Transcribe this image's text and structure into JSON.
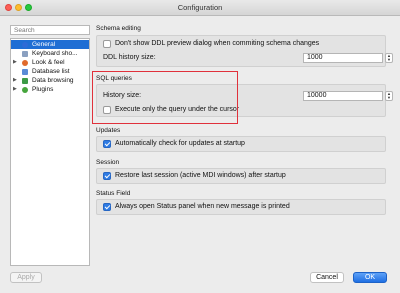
{
  "window": {
    "title": "Configuration"
  },
  "sidebar": {
    "search_placeholder": "Search",
    "items": [
      {
        "label": "General",
        "selected": true,
        "expandable": false,
        "icon_color": "#2e6bd6"
      },
      {
        "label": "Keyboard sho...",
        "selected": false,
        "expandable": false,
        "icon_color": "#8aa0c0"
      },
      {
        "label": "Look & feel",
        "selected": false,
        "expandable": true,
        "icon_color": "#e06a2c"
      },
      {
        "label": "Database list",
        "selected": false,
        "expandable": false,
        "icon_color": "#5a8bd6"
      },
      {
        "label": "Data browsing",
        "selected": false,
        "expandable": true,
        "icon_color": "#3c9a46"
      },
      {
        "label": "Plugins",
        "selected": false,
        "expandable": true,
        "icon_color": "#46a53c"
      }
    ]
  },
  "sections": {
    "schema_editing": {
      "title": "Schema editing",
      "ddl_preview_label": "Don't show DDL preview dialog when commiting schema changes",
      "ddl_preview_checked": false,
      "ddl_history_label": "DDL history size:",
      "ddl_history_value": "1000"
    },
    "sql_queries": {
      "title": "SQL queries",
      "history_label": "History size:",
      "history_value": "10000",
      "exec_under_cursor_label": "Execute only the query under the cursor",
      "exec_under_cursor_checked": false
    },
    "updates": {
      "title": "Updates",
      "auto_check_label": "Automatically check for updates at startup",
      "auto_check_checked": true
    },
    "session": {
      "title": "Session",
      "restore_label": "Restore last session (active MDI windows) after startup",
      "restore_checked": true
    },
    "status_field": {
      "title": "Status Field",
      "open_status_label": "Always open Status panel when new message is printed",
      "open_status_checked": true
    }
  },
  "footer": {
    "apply_label": "Apply",
    "cancel_label": "Cancel",
    "ok_label": "OK"
  },
  "colors": {
    "selection": "#1f6ed4",
    "highlight_box": "#e0313b",
    "checkbox_checked": "#2f7ce4"
  }
}
